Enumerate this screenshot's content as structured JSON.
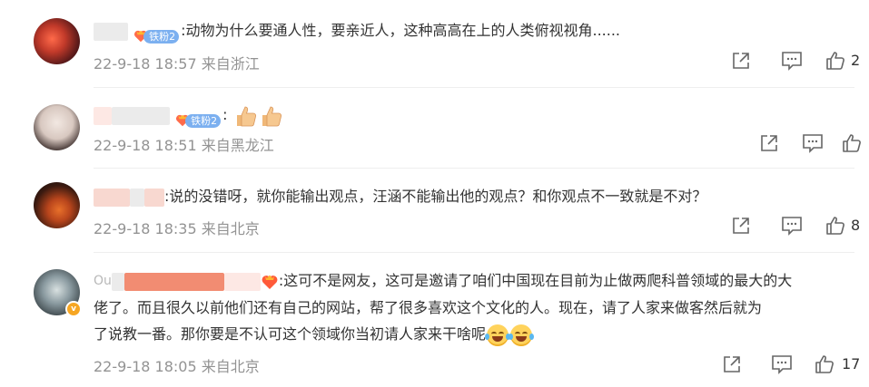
{
  "comments": [
    {
      "fan_badge": "铁粉2",
      "text": ":动物为什么要通人性，要亲近人，这种高高在上的人类俯视视角......",
      "time": "22-9-18 18:57",
      "source": "来自浙江",
      "likes": "2"
    },
    {
      "fan_badge": "铁粉2",
      "text": ":",
      "emoji": [
        "thumbs-up",
        "thumbs-up"
      ],
      "time": "22-9-18 18:51",
      "source": "来自黑龙江",
      "likes": ""
    },
    {
      "text": ":说的没错呀，就你能输出观点，汪涵不能输出他的观点？和你观点不一致就是不对？",
      "time": "22-9-18 18:35",
      "source": "来自北京",
      "likes": "8"
    },
    {
      "name_prefix": "Ou",
      "text_line1": ":这可不是网友，这可是邀请了咱们中国现在目前为止做两爬科普领域的最大的大",
      "text_line2": "佬了。而且很久以前他们还有自己的网站，帮了很多喜欢这个文化的人。现在，请了人家来做客然后就为",
      "text_line3": "了说教一番。那你要是不认可这个领域你当初请人家来干啥呢",
      "time": "22-9-18 18:05",
      "source": "来自北京",
      "likes": "17"
    }
  ],
  "colors": {
    "meta_gray": "#939393",
    "icon_gray": "#666666",
    "fan_badge_blue": "#7cb0f0",
    "verified_orange": "#f6a623"
  },
  "icons": [
    "share-icon",
    "comment-icon",
    "like-icon"
  ]
}
